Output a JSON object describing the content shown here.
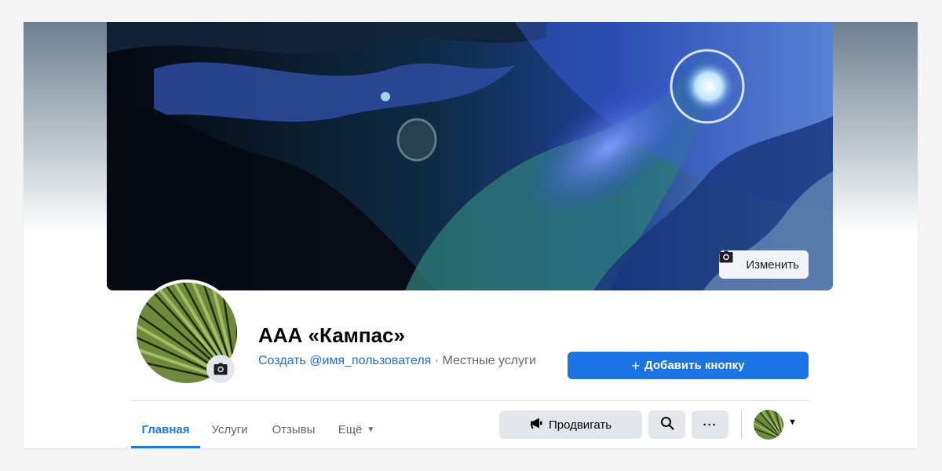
{
  "colors": {
    "primary": "#1b74e4",
    "link": "#216fdb",
    "tab_active": "#1877f2",
    "secondary_text": "#65676b",
    "button_gray": "#e4e6eb"
  },
  "cover": {
    "edit_label": "Изменить",
    "edit_icon": "camera-icon"
  },
  "profile": {
    "name": "ААА «Кампас»",
    "username_link": "Создать @имя_пользователя",
    "separator": " · ",
    "category": "Местные услуги",
    "avatar_edit_icon": "camera-icon"
  },
  "actions": {
    "add_button_icon": "plus-icon",
    "add_button_label": "Добавить кнопку"
  },
  "tabs": [
    {
      "label": "Главная",
      "active": true
    },
    {
      "label": "Услуги",
      "active": false
    },
    {
      "label": "Отзывы",
      "active": false
    },
    {
      "label": "Ещё",
      "active": false
    }
  ],
  "toolbar": {
    "promote_label": "Продвигать",
    "promote_icon": "megaphone-icon",
    "search_icon": "search-icon",
    "more_icon": "more-icon",
    "more_glyph": "···",
    "account_caret_icon": "caret-down-icon"
  }
}
